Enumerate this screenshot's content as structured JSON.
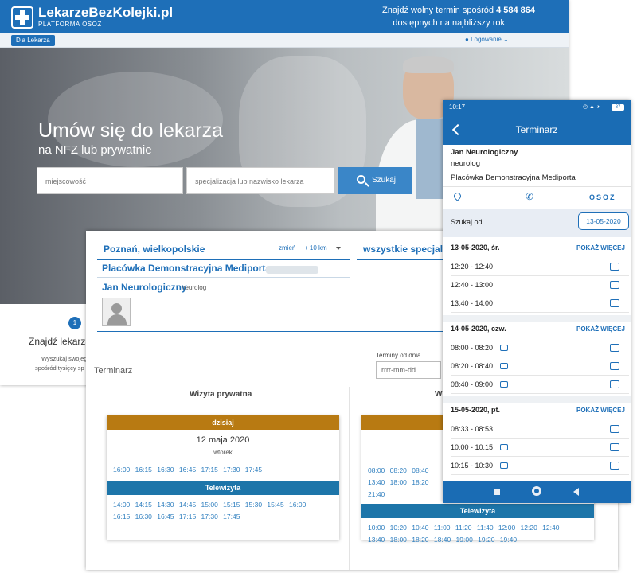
{
  "desktop": {
    "logo_title": "LekarzeBezKolejki.pl",
    "logo_sub": "PLATFORMA OSOZ",
    "promo_prefix": "Znajdź wolny termin spośród",
    "promo_count": "4 584 864",
    "promo_line2": "dostępnych na najbliższy rok",
    "for_doctors": "Dla Lekarza",
    "login": "Logowanie",
    "hero_title": "Umów się do lekarza",
    "hero_sub": "na NFZ lub prywatnie",
    "city_placeholder": "miejscowość",
    "spec_placeholder": "specjalizacja lub nazwisko lekarza",
    "search_btn": "Szukaj",
    "step_num": "1",
    "step_title": "Znajdź lekarza",
    "step_line1": "Wyszukaj swojeg",
    "step_line2": "spośród tysięcy sp"
  },
  "panel": {
    "location": "Poznań, wielkopolskie",
    "change": "zmień",
    "radius": "+ 10 km",
    "spec_all": "wszystkie specjaln",
    "clinic": "Placówka Demonstracyjna Mediporta",
    "doctor_name": "Jan Neurologiczny",
    "doctor_spec": "neurolog",
    "calendar_title": "Terminarz",
    "date_from_label": "Terminy od dnia",
    "date_placeholder": "rrrr-mm-dd",
    "col1_title": "Wizyta prywatna",
    "col2_title": "W",
    "card1": {
      "today": "dzisiaj",
      "date": "12 maja 2020",
      "weekday": "wtorek",
      "times": "16:00 16:15 16:30 16:45 17:15 17:30 17:45",
      "tele_label": "Telewizyta",
      "tele_times_1": "14:00 14:15 14:30 14:45 15:00 15:15 15:30 15:45 16:00",
      "tele_times_2": "16:15 16:30 16:45 17:15 17:30 17:45"
    },
    "card2": {
      "times_1": "08:00 08:20 08:40",
      "times_2": "13:40 18:00 18:20",
      "times_3": "21:40",
      "tele_label": "Telewizyta",
      "tele_times_1": "10:00 10:20 10:40 11:00 11:20 11:40 12:00 12:20 12:40",
      "tele_times_2": "13:40 18:00 18:20 18:40 19:00 19:20 19:40"
    }
  },
  "phone": {
    "time": "10:17",
    "battery": "87",
    "title": "Terminarz",
    "doctor": "Jan Neurologiczny",
    "spec": "neurolog",
    "clinic": "Placówka Demonstracyjna Mediporta",
    "osoz": "OSOZ",
    "search_label": "Szukaj od",
    "search_date": "13-05-2020",
    "more_label": "POKAŻ WIĘCEJ",
    "days": [
      {
        "label": "13-05-2020, śr.",
        "slots": [
          "12:20 - 12:40",
          "12:40 - 13:00",
          "13:40 - 14:00"
        ]
      },
      {
        "label": "14-05-2020, czw.",
        "slots": [
          "08:00 - 08:20",
          "08:20 - 08:40",
          "08:40 - 09:00"
        ]
      },
      {
        "label": "15-05-2020, pt.",
        "slots": [
          "08:33 - 08:53",
          "10:00 - 10:15",
          "10:15 - 10:30"
        ]
      }
    ]
  },
  "colors": {
    "primary": "#1e6fb8",
    "today_header": "#b87a12",
    "tele_header": "#1d75a9"
  }
}
